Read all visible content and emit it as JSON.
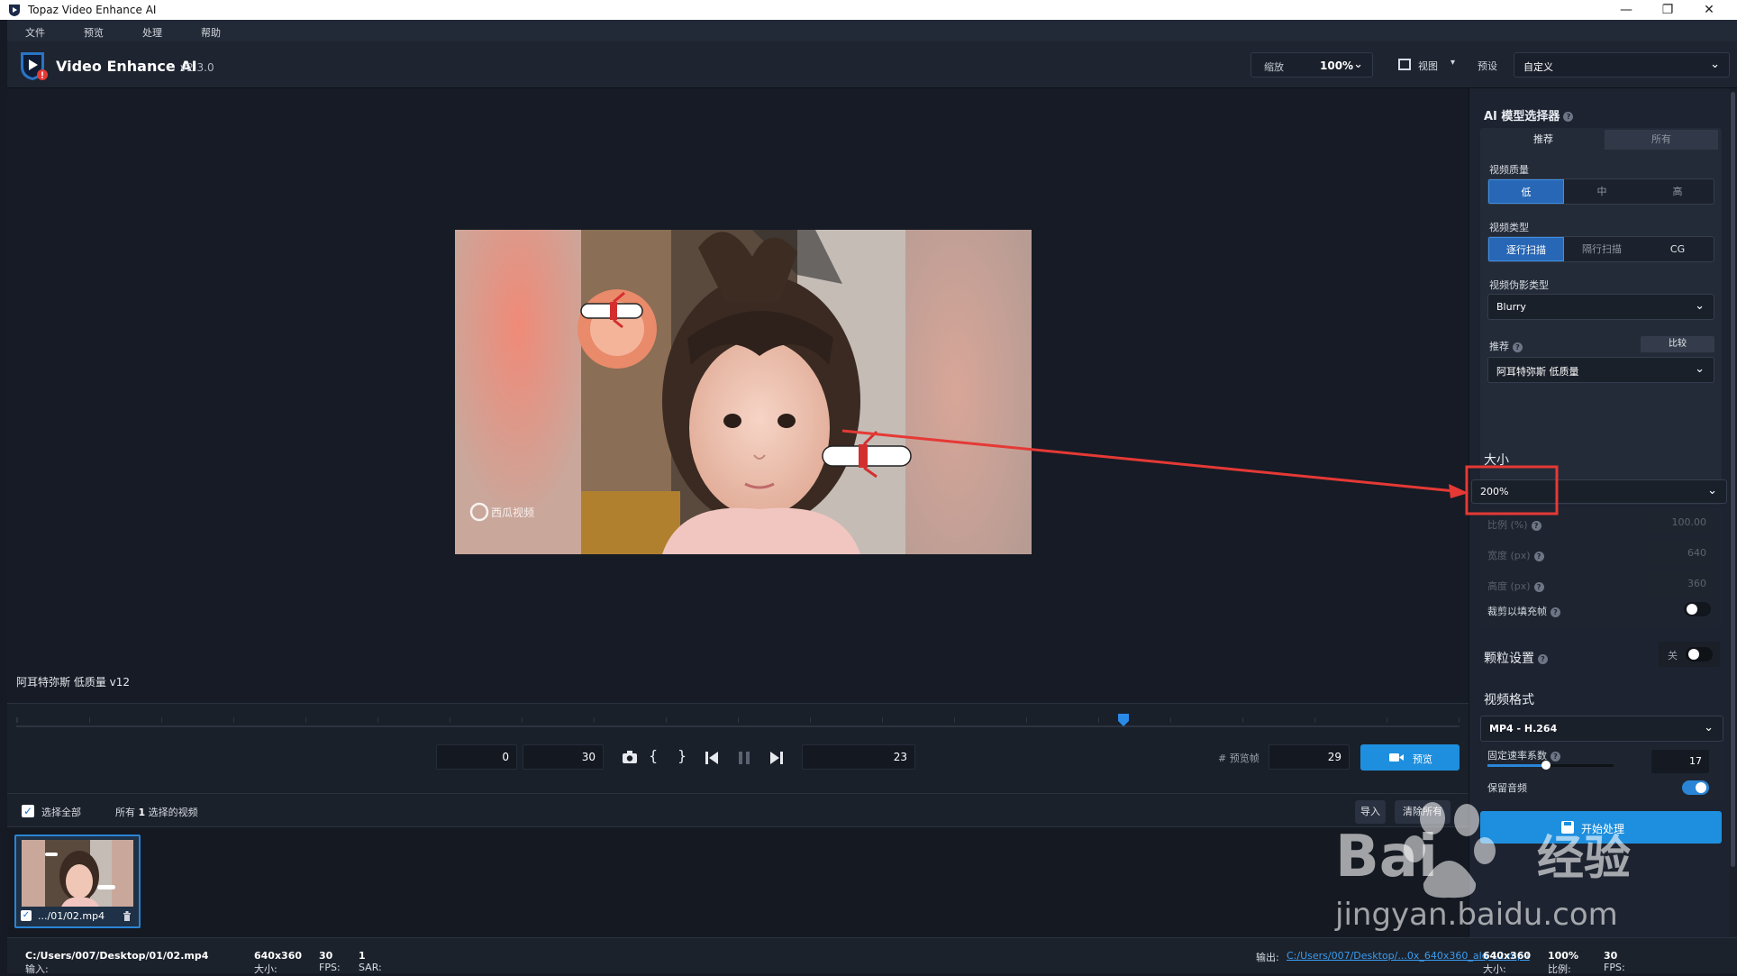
{
  "window": {
    "title": "Topaz Video Enhance AI"
  },
  "menu": [
    "文件",
    "预览",
    "处理",
    "帮助"
  ],
  "header": {
    "app_name": "Video Enhance AI",
    "version": "v2.3.0",
    "zoom_label": "缩放",
    "zoom_value": "100%",
    "view_label": "视图",
    "preset_label": "预设",
    "preset_value": "自定义"
  },
  "preview": {
    "model_caption": "阿耳特弥斯 低质量 v12",
    "overlay_logo_text": "西瓜视频"
  },
  "timeline": {
    "start": "0",
    "end": "30",
    "current": "23",
    "preview_frames_label": "# 预览帧",
    "preview_frames": "29",
    "preview_button": "预览"
  },
  "queue": {
    "select_all": "选择全部",
    "summary_prefix": "所有 ",
    "summary_count": "1",
    "summary_suffix": " 选择的视频",
    "import_button": "导入",
    "clear_button": "清除所有",
    "items": [
      {
        "name": ".../01/02.mp4"
      }
    ]
  },
  "panel": {
    "ai_model_title": "AI 模型选择器",
    "tabs": [
      "推荐",
      "所有"
    ],
    "quality_label": "视频质量",
    "quality_options": [
      "低",
      "中",
      "高"
    ],
    "type_label": "视频类型",
    "type_options": [
      "逐行扫描",
      "隔行扫描",
      "CG"
    ],
    "artifact_label": "视频伪影类型",
    "artifact_value": "Blurry",
    "recommend_label": "推荐",
    "compare_button": "比较",
    "recommend_value": "阿耳特弥斯 低质量",
    "size_title": "大小",
    "size_value": "200%",
    "scale_label": "比例 (%)",
    "scale_value": "100.00",
    "width_label": "宽度 (px)",
    "width_value": "640",
    "height_label": "高度 (px)",
    "height_value": "360",
    "crop_label": "裁剪以填充帧",
    "grain_title": "颗粒设置",
    "grain_toggle_label": "关",
    "format_title": "视频格式",
    "format_value": "MP4 - H.264",
    "crf_label": "固定速率系数",
    "crf_value": "17",
    "audio_label": "保留音频",
    "start_button": "开始处理"
  },
  "status": {
    "input_label": "输入:",
    "input_path": "C:/Users/007/Desktop/01/02.mp4",
    "in_size_label": "大小:",
    "in_size": "640x360",
    "in_fps_label": "FPS:",
    "in_fps": "30",
    "sar_label": "SAR:",
    "sar": "1",
    "output_label": "输出:",
    "output_path": "C:/Users/007/Desktop/...0x_640x360_alq-12.mp4",
    "out_size_label": "大小:",
    "out_size": "640x360",
    "ratio_label": "比例:",
    "ratio": "100%",
    "out_fps_label": "FPS:",
    "out_fps": "30"
  },
  "watermark": {
    "brand": "Bai",
    "brand_cn": "经验",
    "url": "jingyan.baidu.com"
  },
  "colors": {
    "accent": "#1e8fde",
    "selected": "#2767b6",
    "annotation": "#e53935"
  }
}
